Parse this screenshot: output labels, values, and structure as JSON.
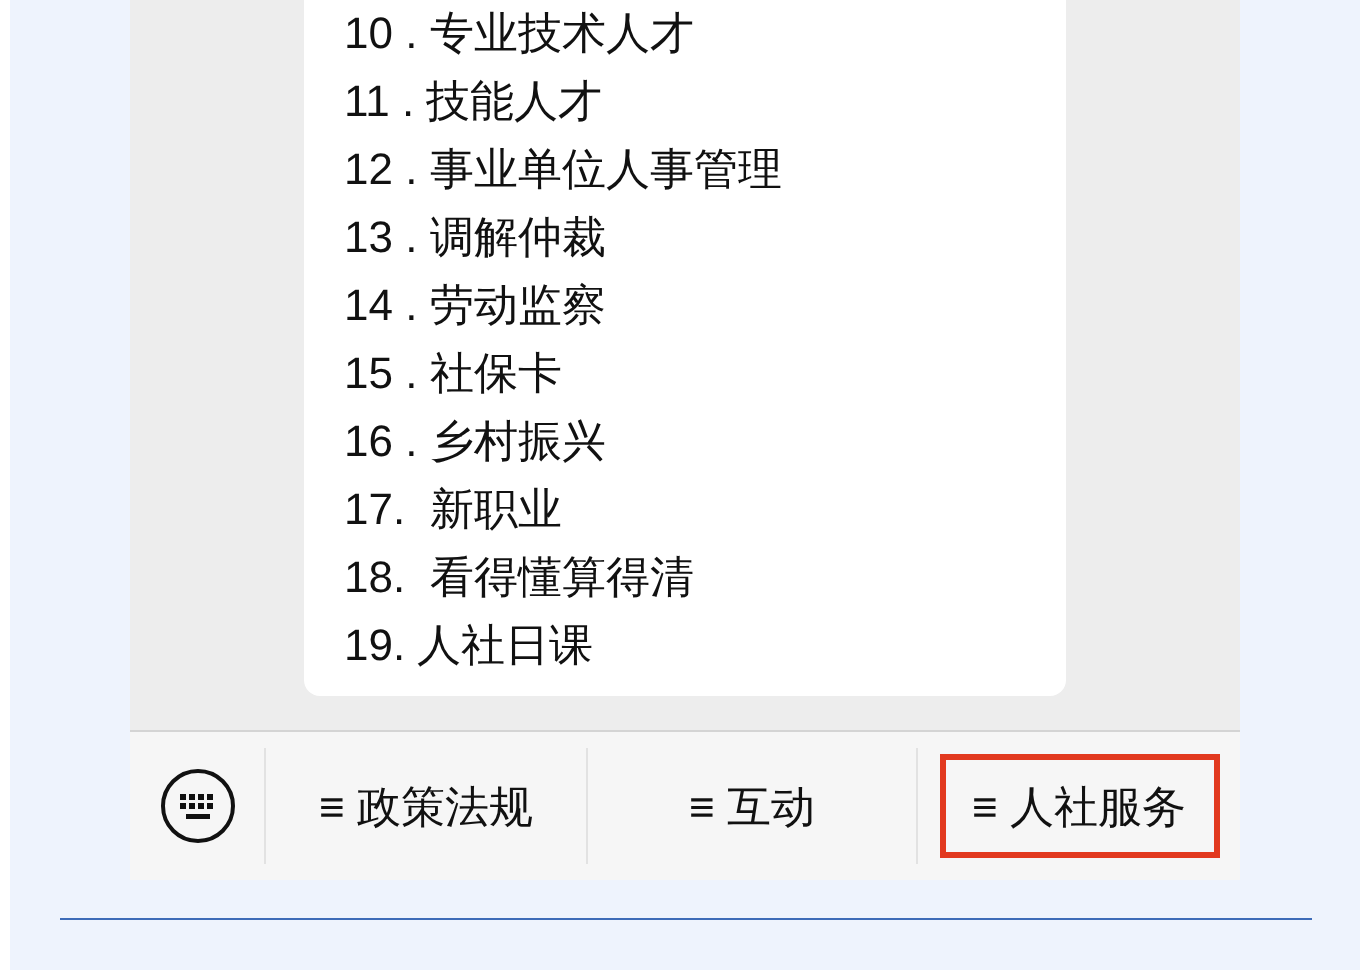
{
  "message": {
    "lines": [
      "10 . 专业技术人才",
      "11 . 技能人才",
      "12 . 事业单位人事管理",
      "13 . 调解仲裁",
      "14 . 劳动监察",
      "15 . 社保卡",
      "16 . 乡村振兴",
      "17.  新职业",
      "18.  看得懂算得清",
      "19. 人社日课"
    ]
  },
  "menu": [
    {
      "label": "≡ 政策法规",
      "highlighted": false
    },
    {
      "label": "≡ 互动",
      "highlighted": false
    },
    {
      "label": "≡ 人社服务",
      "highlighted": true
    }
  ]
}
